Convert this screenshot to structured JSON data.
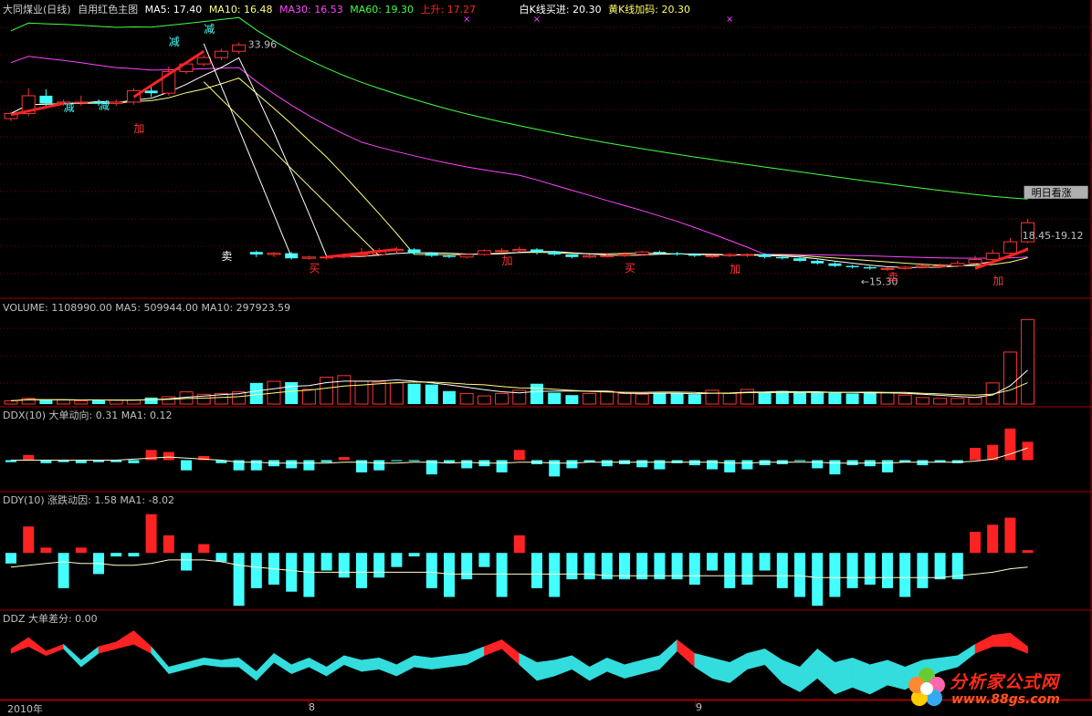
{
  "main_header": {
    "stock": "大同煤业(日线)",
    "template": "自用红色主图",
    "ma5": "MA5: 17.40",
    "ma10": "MA10: 16.48",
    "ma30": "MA30: 16.53",
    "ma60": "MA60: 19.30",
    "rise": "上升: 17.27",
    "white_k": "白K线买进: 20.30",
    "yellow_k": "黄K线加码: 20.30"
  },
  "volume_header": "VOLUME: 1108990.00  MA5: 509944.00  MA10: 297923.59",
  "ddx_header": "DDX(10)  大单动向: 0.31  MA1: 0.12",
  "ddy_header": "DDY(10)  涨跌动因: 1.58  MA1: -8.02",
  "ddz_header": "DDZ  大单差分: 0.00",
  "x_axis_labels": [
    "2010年",
    "8",
    "9"
  ],
  "logo": {
    "title": "分析家公式网",
    "url": "www.88gs.com"
  },
  "colors": {
    "up": "#ff3333",
    "down": "#44ffff",
    "ma5": "#ffffff",
    "ma10": "#ffff80",
    "ma30": "#ff44ff",
    "ma60": "#44ff44",
    "rise": "#ff2222",
    "grid": "#7a0000"
  },
  "chart_data": [
    {
      "type": "candlestick",
      "panel": "main",
      "title": "大同煤业(日线) 自用红色主图",
      "x": [
        1,
        2,
        3,
        4,
        5,
        6,
        7,
        8,
        9,
        10,
        11,
        12,
        13,
        14,
        15,
        16,
        17,
        18,
        19,
        20,
        21,
        22,
        23,
        24,
        25,
        26,
        27,
        28,
        29,
        30,
        31,
        32,
        33,
        34,
        35,
        36,
        37,
        38,
        39,
        40,
        41,
        42,
        43,
        44,
        45,
        46,
        47,
        48,
        49,
        50,
        51,
        52,
        53,
        54,
        55,
        56,
        57,
        58,
        59
      ],
      "open": [
        28.1,
        28.5,
        29.9,
        29.3,
        29.4,
        29.4,
        29.3,
        29.4,
        30.3,
        30.1,
        31.8,
        32.4,
        32.9,
        33.4,
        17.6,
        17.4,
        17.5,
        17.1,
        17.2,
        17.2,
        17.3,
        17.4,
        17.7,
        17.8,
        17.5,
        17.3,
        17.2,
        17.4,
        17.7,
        17.7,
        17.8,
        17.6,
        17.4,
        17.2,
        17.3,
        17.3,
        17.4,
        17.6,
        17.5,
        17.4,
        17.3,
        17.3,
        17.4,
        17.4,
        17.2,
        17.1,
        16.9,
        16.7,
        16.5,
        16.4,
        16.3,
        16.3,
        16.4,
        16.5,
        16.5,
        16.7,
        17.0,
        17.5,
        18.4
      ],
      "close": [
        28.5,
        29.9,
        29.3,
        29.4,
        29.4,
        29.3,
        29.4,
        30.3,
        30.1,
        31.8,
        32.4,
        32.9,
        33.4,
        33.9,
        17.4,
        17.5,
        17.1,
        17.2,
        17.2,
        17.3,
        17.4,
        17.7,
        17.8,
        17.5,
        17.3,
        17.2,
        17.4,
        17.7,
        17.7,
        17.8,
        17.6,
        17.4,
        17.2,
        17.3,
        17.3,
        17.4,
        17.6,
        17.5,
        17.4,
        17.3,
        17.3,
        17.4,
        17.4,
        17.2,
        17.1,
        16.9,
        16.7,
        16.5,
        16.4,
        16.3,
        16.3,
        16.4,
        16.5,
        16.5,
        16.7,
        17.0,
        17.5,
        18.4,
        19.9
      ],
      "high": [
        28.6,
        30.5,
        30.4,
        29.6,
        29.9,
        29.6,
        29.6,
        30.5,
        30.6,
        32.2,
        32.6,
        33.1,
        33.6,
        34.1,
        17.7,
        17.6,
        17.6,
        17.3,
        17.3,
        17.5,
        17.9,
        17.9,
        18.0,
        17.9,
        17.6,
        17.4,
        17.5,
        17.8,
        17.9,
        18.0,
        17.9,
        17.7,
        17.4,
        17.4,
        17.5,
        17.6,
        17.7,
        17.7,
        17.6,
        17.5,
        17.4,
        17.5,
        17.5,
        17.5,
        17.3,
        17.2,
        17.0,
        16.8,
        16.6,
        16.5,
        16.4,
        16.5,
        16.6,
        16.7,
        16.9,
        17.3,
        17.8,
        18.7,
        20.2
      ],
      "low": [
        27.9,
        28.3,
        29.0,
        29.1,
        29.1,
        29.1,
        29.1,
        29.2,
        29.8,
        29.9,
        31.6,
        32.2,
        32.7,
        33.2,
        17.2,
        17.2,
        17.0,
        17.0,
        17.0,
        17.1,
        17.2,
        17.3,
        17.5,
        17.4,
        17.2,
        17.1,
        17.1,
        17.3,
        17.5,
        17.6,
        17.4,
        17.3,
        17.1,
        17.1,
        17.2,
        17.2,
        17.3,
        17.4,
        17.3,
        17.2,
        17.1,
        17.2,
        17.2,
        17.1,
        17.0,
        16.8,
        16.6,
        16.4,
        16.3,
        16.2,
        16.1,
        16.2,
        16.3,
        16.4,
        16.4,
        16.6,
        16.9,
        17.4,
        18.3
      ],
      "annotations": {
        "peak_label": "33.96",
        "low_label": "←15.30",
        "range_label": "18.45-19.12",
        "forecast_label": "明日看涨",
        "jia": "加",
        "jian": "减",
        "mai": "买",
        "mai4": "卖"
      },
      "ylim": [
        14.6,
        36.0
      ]
    },
    {
      "type": "bar",
      "panel": "volume",
      "title": "VOLUME: 1108990.00  MA5: 509944.00  MA10: 297923.59",
      "x": [
        1,
        2,
        3,
        4,
        5,
        6,
        7,
        8,
        9,
        10,
        11,
        12,
        13,
        14,
        15,
        16,
        17,
        18,
        19,
        20,
        21,
        22,
        23,
        24,
        25,
        26,
        27,
        28,
        29,
        30,
        31,
        32,
        33,
        34,
        35,
        36,
        37,
        38,
        39,
        40,
        41,
        42,
        43,
        44,
        45,
        46,
        47,
        48,
        49,
        50,
        51,
        52,
        53,
        54,
        55,
        56,
        57,
        58,
        59
      ],
      "values": [
        40,
        70,
        50,
        50,
        40,
        50,
        50,
        50,
        80,
        90,
        150,
        120,
        130,
        150,
        260,
        280,
        270,
        180,
        330,
        350,
        280,
        270,
        260,
        250,
        240,
        160,
        130,
        100,
        130,
        170,
        250,
        140,
        110,
        130,
        160,
        130,
        120,
        130,
        130,
        120,
        170,
        130,
        180,
        140,
        160,
        140,
        140,
        140,
        130,
        140,
        140,
        110,
        80,
        70,
        70,
        80,
        260,
        640,
        1040
      ],
      "ylim": [
        0,
        1100
      ]
    },
    {
      "type": "bar",
      "panel": "ddx",
      "title": "DDX(10) 大单动向: 0.31 MA1: 0.12",
      "x": [
        1,
        2,
        3,
        4,
        5,
        6,
        7,
        8,
        9,
        10,
        11,
        12,
        13,
        14,
        15,
        16,
        17,
        18,
        19,
        20,
        21,
        22,
        23,
        24,
        25,
        26,
        27,
        28,
        29,
        30,
        31,
        32,
        33,
        34,
        35,
        36,
        37,
        38,
        39,
        40,
        41,
        42,
        43,
        44,
        45,
        46,
        47,
        48,
        49,
        50,
        51,
        52,
        53,
        54,
        55,
        56,
        57,
        58,
        59
      ],
      "values": [
        -0.02,
        0.05,
        -0.03,
        -0.02,
        -0.03,
        -0.02,
        -0.02,
        -0.03,
        0.1,
        0.08,
        -0.1,
        0.04,
        -0.03,
        -0.1,
        -0.1,
        -0.06,
        -0.08,
        -0.1,
        -0.02,
        0.03,
        -0.12,
        -0.1,
        -0.01,
        -0.01,
        -0.14,
        -0.03,
        -0.08,
        -0.06,
        -0.12,
        0.1,
        -0.04,
        -0.16,
        -0.08,
        -0.02,
        -0.06,
        -0.04,
        -0.07,
        -0.09,
        -0.03,
        -0.05,
        -0.09,
        -0.12,
        -0.09,
        -0.05,
        -0.04,
        -0.01,
        -0.08,
        -0.14,
        -0.05,
        -0.06,
        -0.12,
        -0.02,
        -0.05,
        -0.02,
        -0.03,
        0.12,
        0.15,
        0.31,
        0.18
      ],
      "ma1": [
        0.0,
        0.0,
        0.0,
        0.0,
        0.0,
        0.0,
        0.0,
        0.01,
        0.02,
        0.03,
        0.02,
        0.01,
        0.0,
        -0.02,
        -0.02,
        -0.03,
        -0.03,
        -0.03,
        -0.03,
        -0.02,
        -0.02,
        -0.03,
        -0.03,
        -0.02,
        -0.02,
        -0.03,
        -0.02,
        -0.03,
        -0.03,
        -0.02,
        -0.02,
        -0.03,
        -0.03,
        -0.02,
        -0.02,
        -0.02,
        -0.02,
        -0.02,
        -0.02,
        -0.02,
        -0.02,
        -0.03,
        -0.03,
        -0.02,
        -0.02,
        -0.02,
        -0.02,
        -0.03,
        -0.03,
        -0.03,
        -0.03,
        -0.02,
        -0.02,
        -0.02,
        -0.02,
        -0.01,
        0.01,
        0.06,
        0.12
      ],
      "ylim": [
        -0.3,
        0.38
      ]
    },
    {
      "type": "bar",
      "panel": "ddy",
      "title": "DDY(10) 涨跌动因: 1.58 MA1: -8.02",
      "x": [
        1,
        2,
        3,
        4,
        5,
        6,
        7,
        8,
        9,
        10,
        11,
        12,
        13,
        14,
        15,
        16,
        17,
        18,
        19,
        20,
        21,
        22,
        23,
        24,
        25,
        26,
        27,
        28,
        29,
        30,
        31,
        32,
        33,
        34,
        35,
        36,
        37,
        38,
        39,
        40,
        41,
        42,
        43,
        44,
        45,
        46,
        47,
        48,
        49,
        50,
        51,
        52,
        53,
        54,
        55,
        56,
        57,
        58,
        59
      ],
      "values": [
        -6,
        15,
        3,
        -20,
        3,
        -12,
        -2,
        -2,
        22,
        10,
        -10,
        5,
        -5,
        -30,
        -20,
        -18,
        -22,
        -25,
        -10,
        -14,
        -20,
        -14,
        -8,
        -2,
        -20,
        -25,
        -15,
        -8,
        -25,
        10,
        -20,
        -25,
        -15,
        -15,
        -15,
        -15,
        -15,
        -15,
        -15,
        -18,
        -10,
        -20,
        -18,
        -10,
        -20,
        -25,
        -30,
        -25,
        -20,
        -18,
        -20,
        -25,
        -20,
        -15,
        -15,
        12,
        16,
        20,
        1.58
      ],
      "ma1": [
        -8,
        -7,
        -6,
        -5,
        -6,
        -6,
        -7,
        -7,
        -6,
        -4,
        -4,
        -4,
        -5,
        -7,
        -8,
        -9,
        -10,
        -11,
        -11,
        -11,
        -11,
        -11,
        -11,
        -11,
        -11,
        -12,
        -12,
        -12,
        -12,
        -12,
        -12,
        -12,
        -12,
        -12,
        -13,
        -13,
        -13,
        -13,
        -13,
        -13,
        -13,
        -13,
        -13,
        -13,
        -13,
        -13,
        -14,
        -14,
        -14,
        -14,
        -14,
        -14,
        -14,
        -14,
        -13,
        -12,
        -11,
        -9,
        -8.02
      ],
      "ylim": [
        -32,
        26
      ]
    },
    {
      "type": "area",
      "panel": "ddz",
      "title": "DDZ 大单差分: 0.00",
      "x": [
        1,
        2,
        3,
        4,
        5,
        6,
        7,
        8,
        9,
        10,
        11,
        12,
        13,
        14,
        15,
        16,
        17,
        18,
        19,
        20,
        21,
        22,
        23,
        24,
        25,
        26,
        27,
        28,
        29,
        30,
        31,
        32,
        33,
        34,
        35,
        36,
        37,
        38,
        39,
        40,
        41,
        42,
        43,
        44,
        45,
        46,
        47,
        48,
        49,
        50,
        51,
        52,
        53,
        54,
        55,
        56,
        57,
        58,
        59
      ],
      "upper": [
        0.2,
        0.7,
        0.1,
        0.4,
        -0.3,
        0.3,
        0.5,
        1.0,
        0.3,
        -0.6,
        -0.4,
        -0.2,
        -0.3,
        -0.2,
        -0.8,
        0.0,
        -0.5,
        -0.2,
        -0.6,
        -0.1,
        -0.3,
        -0.2,
        -0.5,
        -0.1,
        -0.2,
        -0.1,
        0.0,
        0.3,
        0.6,
        0.0,
        -0.4,
        -0.3,
        -0.1,
        -0.6,
        -0.2,
        -0.5,
        -0.3,
        -0.1,
        0.6,
        0.0,
        -0.2,
        -0.4,
        0.0,
        0.2,
        -0.3,
        -0.6,
        0.2,
        -0.4,
        -0.2,
        -0.5,
        -0.3,
        -0.6,
        -0.3,
        -0.2,
        -0.1,
        0.4,
        0.8,
        0.9,
        0.3
      ],
      "lower": [
        0.0,
        0.3,
        -0.1,
        0.2,
        -0.6,
        0.0,
        0.2,
        0.4,
        0.0,
        -0.9,
        -0.7,
        -0.5,
        -0.6,
        -0.6,
        -1.2,
        -0.4,
        -0.9,
        -0.6,
        -1.0,
        -0.5,
        -0.8,
        -0.7,
        -1.0,
        -0.6,
        -0.7,
        -0.6,
        -0.5,
        -0.1,
        0.2,
        -0.5,
        -1.2,
        -1.0,
        -0.7,
        -1.2,
        -0.8,
        -1.1,
        -0.9,
        -0.7,
        0.1,
        -0.6,
        -1.1,
        -1.3,
        -0.7,
        -0.5,
        -1.3,
        -1.7,
        -1.1,
        -1.8,
        -1.5,
        -1.8,
        -1.4,
        -1.6,
        -1.2,
        -0.8,
        -0.6,
        0.0,
        0.3,
        0.3,
        0.0
      ],
      "ylim": [
        -2.0,
        1.3
      ]
    }
  ]
}
